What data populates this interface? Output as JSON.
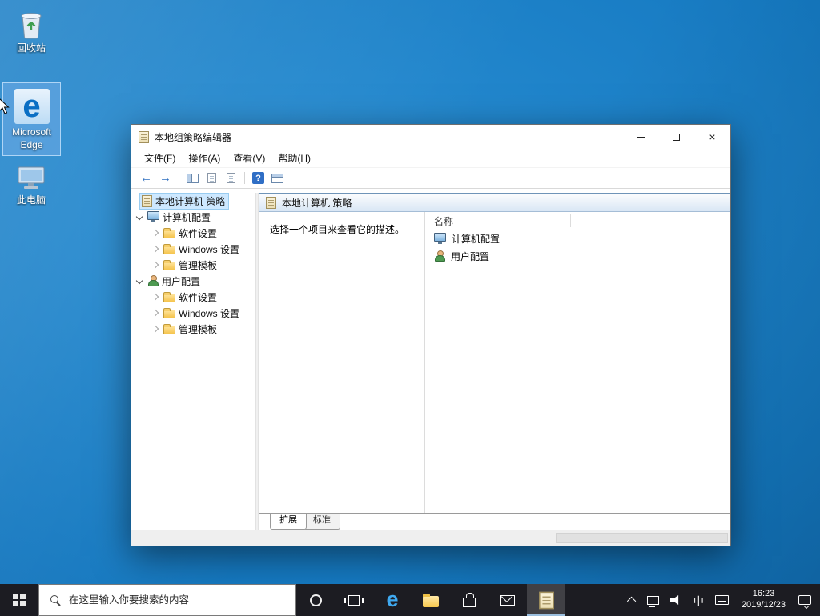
{
  "glyphs": {
    "edge": "e"
  },
  "desktop": {
    "icons": [
      {
        "label": "回收站"
      },
      {
        "label": "Microsoft Edge"
      },
      {
        "label": "此电脑"
      }
    ]
  },
  "window": {
    "title": "本地组策略编辑器",
    "controls": {
      "close": "×"
    },
    "menu": [
      {
        "label": "文件(F)"
      },
      {
        "label": "操作(A)"
      },
      {
        "label": "查看(V)"
      },
      {
        "label": "帮助(H)"
      }
    ],
    "toolbar": {
      "back": "←",
      "forward": "→",
      "help": "?"
    },
    "tree": {
      "items": [
        {
          "label": "本地计算机 策略"
        },
        {
          "label": "计算机配置"
        },
        {
          "label": "软件设置"
        },
        {
          "label": "Windows 设置"
        },
        {
          "label": "管理模板"
        },
        {
          "label": "用户配置"
        },
        {
          "label": "软件设置"
        },
        {
          "label": "Windows 设置"
        },
        {
          "label": "管理模板"
        }
      ]
    },
    "content": {
      "header": "本地计算机 策略",
      "description": "选择一个项目来查看它的描述。",
      "column_header": "名称",
      "items": [
        {
          "label": "计算机配置"
        },
        {
          "label": "用户配置"
        }
      ],
      "tabs": [
        {
          "label": "扩展"
        },
        {
          "label": "标准"
        }
      ]
    }
  },
  "taskbar": {
    "search_placeholder": "在这里输入你要搜索的内容",
    "tray": {
      "input_method": "中",
      "time": "16:23",
      "date": "2019/12/23"
    }
  }
}
